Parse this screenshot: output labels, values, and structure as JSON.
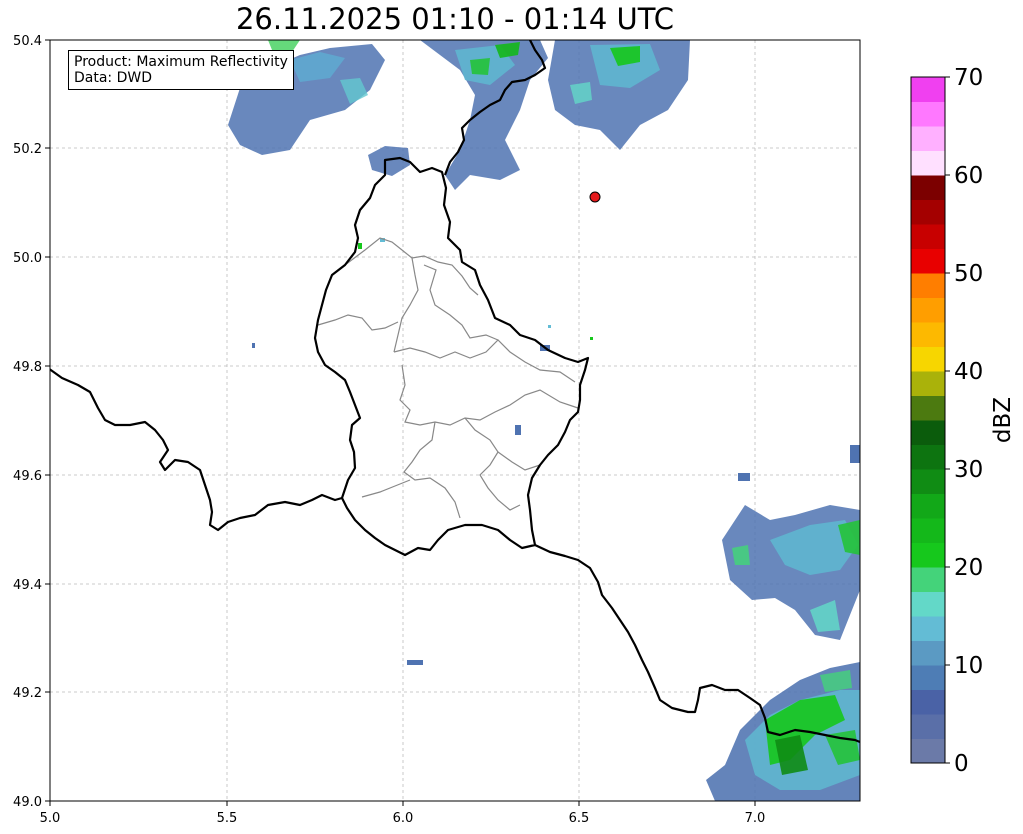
{
  "title": "26.11.2025 01:10 - 01:14 UTC",
  "info_box": {
    "line1": "Product: Maximum Reflectivity",
    "line2": "Data: DWD"
  },
  "map": {
    "x_ticks": [
      "5.0",
      "5.5",
      "6.0",
      "6.5",
      "7.0"
    ],
    "y_ticks": [
      "50.4",
      "50.2",
      "50.0",
      "49.8",
      "49.6",
      "49.4",
      "49.2",
      "49.0"
    ],
    "lon_range": [
      5.0,
      7.3
    ],
    "lat_range": [
      49.0,
      50.4
    ],
    "grid": true,
    "marker": {
      "lon": 6.55,
      "lat": 50.11,
      "color": "#e41a1c"
    }
  },
  "colorbar": {
    "label": "dBZ",
    "ticks": [
      "0",
      "10",
      "20",
      "30",
      "40",
      "50",
      "60",
      "70"
    ],
    "range": [
      0,
      70
    ],
    "colors": [
      "#6b7aa8",
      "#5a6fa8",
      "#4a62a6",
      "#4e7db5",
      "#5b9ac3",
      "#63bcd5",
      "#63d8c8",
      "#44d37a",
      "#16c81c",
      "#14b81a",
      "#12a818",
      "#108c14",
      "#0d7410",
      "#0b5c0c",
      "#4c7a10",
      "#aab20a",
      "#f7d600",
      "#fdb900",
      "#ff9e00",
      "#ff7e00",
      "#e80000",
      "#c80000",
      "#a40000",
      "#7c0000",
      "#ffe0ff",
      "#ffb0ff",
      "#ff78ff",
      "#f040f0"
    ]
  }
}
